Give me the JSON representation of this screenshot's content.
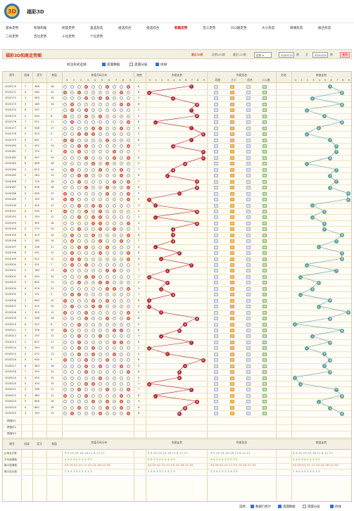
{
  "site": {
    "title": "福彩3D"
  },
  "nav": {
    "row1": [
      "基本走势",
      "和值和尾",
      "跨度走势",
      "直选形态",
      "组选综合",
      "组选综合",
      "和尾走势",
      "百三走势",
      "012路走势",
      "大小形态",
      "奇偶形态",
      "质合形态"
    ],
    "row2": [
      "二码走势",
      "百位走势",
      "十位走势",
      "个位走势"
    ],
    "active_index": 6
  },
  "panel": {
    "title": "福彩3D和尾走势图",
    "recent_50": "最近50期",
    "recent_100": "近期100期",
    "recent_120": "最近120期",
    "select_value": "近年",
    "from_issue": "2020170",
    "to_label": "至",
    "to_issue": "2020225",
    "period_label": "期",
    "query_btn": "查询"
  },
  "options": {
    "label": "标注形式选择：",
    "items": [
      {
        "label": "遗漏数据",
        "checked": true
      },
      {
        "label": "遗漏分层",
        "checked": false
      },
      {
        "label": "拆线",
        "checked": true
      }
    ]
  },
  "table": {
    "headers": {
      "issue": "期号",
      "machine": "机球",
      "draw": "奖号",
      "sum": "和值",
      "sum_dist": "和值号码分布",
      "span": "跨度",
      "tail": "和尾",
      "tail_trend": "和尾走势",
      "tail_form": "和尾形态",
      "form_cols": [
        "奇偶",
        "大小",
        "质合",
        "012路"
      ],
      "shape": "形态",
      "span_trend": "跨度走势",
      "digits": [
        "0",
        "1",
        "2",
        "3",
        "4",
        "5",
        "6",
        "7",
        "8",
        "9"
      ]
    },
    "rows": [
      {
        "issue": "2020170",
        "m": "7",
        "draw": "369",
        "sum": "18",
        "tail": 7,
        "span": 6
      },
      {
        "issue": "2020171",
        "m": "4",
        "draw": "280",
        "sum": "10",
        "tail": 0,
        "span": 8
      },
      {
        "issue": "2020172",
        "m": "2",
        "draw": "563",
        "sum": "14",
        "tail": 4,
        "span": 3
      },
      {
        "issue": "2020173",
        "m": "3",
        "draw": "189",
        "sum": "18",
        "tail": 8,
        "span": 8
      },
      {
        "issue": "2020174",
        "m": "6",
        "draw": "331",
        "sum": "7",
        "tail": 7,
        "span": 2
      },
      {
        "issue": "2020175",
        "m": "4",
        "draw": "530",
        "sum": "8",
        "tail": 8,
        "span": 5
      },
      {
        "issue": "2020176",
        "m": "7",
        "draw": "911",
        "sum": "11",
        "tail": 1,
        "span": 8
      },
      {
        "issue": "2020177",
        "m": "0",
        "draw": "548",
        "sum": "17",
        "tail": 7,
        "span": 4
      },
      {
        "issue": "2020178",
        "m": "0",
        "draw": "423",
        "sum": "9",
        "tail": 9,
        "span": 2
      },
      {
        "issue": "2020179",
        "m": "5",
        "draw": "601",
        "sum": "7",
        "tail": 7,
        "span": 6
      },
      {
        "issue": "2020180",
        "m": "3",
        "draw": "392",
        "sum": "14",
        "tail": 4,
        "span": 7
      },
      {
        "issue": "2020181",
        "m": "7",
        "draw": "720",
        "sum": "9",
        "tail": 9,
        "span": 7
      },
      {
        "issue": "2020182",
        "m": "8",
        "draw": "397",
        "sum": "19",
        "tail": 9,
        "span": 6
      },
      {
        "issue": "2020183",
        "m": "6",
        "draw": "646",
        "sum": "16",
        "tail": 6,
        "span": 2
      },
      {
        "issue": "2020184",
        "m": "1",
        "draw": "815",
        "sum": "14",
        "tail": 4,
        "span": 7
      },
      {
        "issue": "2020185",
        "m": "2",
        "draw": "283",
        "sum": "13",
        "tail": 3,
        "span": 6
      },
      {
        "issue": "2020186",
        "m": "7",
        "draw": "729",
        "sum": "18",
        "tail": 8,
        "span": 7
      },
      {
        "issue": "2020187",
        "m": "8",
        "draw": "936",
        "sum": "18",
        "tail": 8,
        "span": 6
      },
      {
        "issue": "2020188",
        "m": "0",
        "draw": "906",
        "sum": "15",
        "tail": 5,
        "span": 9
      },
      {
        "issue": "2020189",
        "m": "7",
        "draw": "190",
        "sum": "10",
        "tail": 0,
        "span": 9
      },
      {
        "issue": "2020190",
        "m": "1",
        "draw": "425",
        "sum": "11",
        "tail": 1,
        "span": 3
      },
      {
        "issue": "2020191",
        "m": "4",
        "draw": "530",
        "sum": "8",
        "tail": 8,
        "span": 5
      },
      {
        "issue": "2020192",
        "m": "3",
        "draw": "254",
        "sum": "11",
        "tail": 1,
        "span": 3
      },
      {
        "issue": "2020193",
        "m": "7",
        "draw": "495",
        "sum": "18",
        "tail": 8,
        "span": 5
      },
      {
        "issue": "2020194",
        "m": "0",
        "draw": "275",
        "sum": "14",
        "tail": 4,
        "span": 5
      },
      {
        "issue": "2020195",
        "m": "6",
        "draw": "419",
        "sum": "14",
        "tail": 4,
        "span": 8
      },
      {
        "issue": "2020196",
        "m": "5",
        "draw": "185",
        "sum": "14",
        "tail": 4,
        "span": 7
      },
      {
        "issue": "2020197",
        "m": "8",
        "draw": "236",
        "sum": "11",
        "tail": 1,
        "span": 4
      },
      {
        "issue": "2020198",
        "m": "9",
        "draw": "591",
        "sum": "15",
        "tail": 5,
        "span": 8
      },
      {
        "issue": "2020199",
        "m": "0",
        "draw": "912",
        "sum": "12",
        "tail": 2,
        "span": 8
      },
      {
        "issue": "2020200",
        "m": "4",
        "draw": "331",
        "sum": "7",
        "tail": 7,
        "span": 2
      },
      {
        "issue": "2020201",
        "m": "3",
        "draw": "760",
        "sum": "13",
        "tail": 3,
        "span": 7
      },
      {
        "issue": "2020202",
        "m": "6",
        "draw": "433",
        "sum": "10",
        "tail": 0,
        "span": 1
      },
      {
        "issue": "2020203",
        "m": "5",
        "draw": "652",
        "sum": "13",
        "tail": 3,
        "span": 4
      },
      {
        "issue": "2020204",
        "m": "9",
        "draw": "976",
        "sum": "22",
        "tail": 2,
        "span": 3
      },
      {
        "issue": "2020205",
        "m": "0",
        "draw": "121",
        "sum": "4",
        "tail": 4,
        "span": 1
      },
      {
        "issue": "2020206",
        "m": "2",
        "draw": "640",
        "sum": "10",
        "tail": 0,
        "span": 6
      },
      {
        "issue": "2020207",
        "m": "3",
        "draw": "415",
        "sum": "10",
        "tail": 0,
        "span": 4
      },
      {
        "issue": "2020208",
        "m": "1",
        "draw": "309",
        "sum": "12",
        "tail": 2,
        "span": 9
      },
      {
        "issue": "2020209",
        "m": "3",
        "draw": "396",
        "sum": "18",
        "tail": 8,
        "span": 6
      },
      {
        "issue": "2020210",
        "m": "6",
        "draw": "222",
        "sum": "6",
        "tail": 6,
        "span": 0
      },
      {
        "issue": "2020211",
        "m": "7",
        "draw": "708",
        "sum": "15",
        "tail": 5,
        "span": 8
      },
      {
        "issue": "2020212",
        "m": "4",
        "draw": "255",
        "sum": "12",
        "tail": 2,
        "span": 3
      },
      {
        "issue": "2020213",
        "m": "2",
        "draw": "872",
        "sum": "17",
        "tail": 7,
        "span": 6
      },
      {
        "issue": "2020214",
        "m": "4",
        "draw": "244",
        "sum": "10",
        "tail": 0,
        "span": 2
      },
      {
        "issue": "2020215",
        "m": "0",
        "draw": "472",
        "sum": "13",
        "tail": 3,
        "span": 5
      },
      {
        "issue": "2020216",
        "m": "5",
        "draw": "630",
        "sum": "9",
        "tail": 9,
        "span": 6
      },
      {
        "issue": "2020217",
        "m": "6",
        "draw": "583",
        "sum": "16",
        "tail": 6,
        "span": 5
      },
      {
        "issue": "2020218",
        "m": "7",
        "draw": "393",
        "sum": "15",
        "tail": 5,
        "span": 6
      },
      {
        "issue": "2020219",
        "m": "4",
        "draw": "555",
        "sum": "15",
        "tail": 5,
        "span": 0
      },
      {
        "issue": "2020220",
        "m": "0",
        "draw": "334",
        "sum": "10",
        "tail": 0,
        "span": 1
      },
      {
        "issue": "2020221",
        "m": "3",
        "draw": "296",
        "sum": "17",
        "tail": 7,
        "span": 7
      },
      {
        "issue": "2020222",
        "m": "4",
        "draw": "380",
        "sum": "11",
        "tail": 1,
        "span": 8
      },
      {
        "issue": "2020223",
        "m": "5",
        "draw": "648",
        "sum": "18",
        "tail": 8,
        "span": 4
      },
      {
        "issue": "2020224",
        "m": "0",
        "draw": "862",
        "sum": "16",
        "tail": 6,
        "span": 6
      },
      {
        "issue": "2020225",
        "m": "3",
        "draw": "159",
        "sum": "15",
        "tail": 5,
        "span": 8
      }
    ],
    "predict_rows": [
      "预选行1",
      "预选行2",
      "预选行3"
    ],
    "stats": [
      {
        "label": "出现总次数",
        "vals": "9 9 25 23 10 18 11 8 11 17",
        "cls": ""
      },
      {
        "label": "平均遗漏值",
        "vals": "4 4 2 3 4 3 5 5 3 2",
        "cls": "g"
      },
      {
        "label": "最大遗漏值",
        "vals": "33 29 42 21 11 23 15 16 12 32",
        "cls": "r"
      },
      {
        "label": "最大连出值",
        "vals": "2 3 4 3 3 2 3 4 3 3",
        "cls": "b"
      }
    ]
  },
  "footer": {
    "label": "选择：",
    "items": [
      {
        "label": "数据行统计",
        "checked": true
      },
      {
        "label": "遗漏数据",
        "checked": true
      },
      {
        "label": "遗漏分层",
        "checked": false
      },
      {
        "label": "拆线",
        "checked": true
      }
    ]
  }
}
